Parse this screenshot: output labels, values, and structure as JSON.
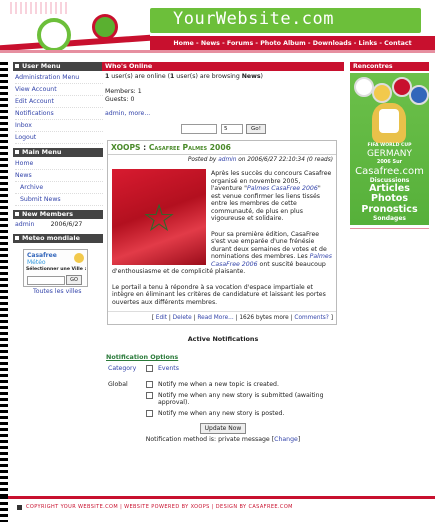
{
  "header": {
    "site_title": "YourWebsite.com",
    "nav": "Home - News - Forums - Photo Album - Downloads - Links - Contact"
  },
  "left": {
    "user_menu": {
      "title": "User Menu",
      "items": [
        "Administration Menu",
        "View Account",
        "Edit Account",
        "Notifications",
        "Inbox",
        "Logout"
      ]
    },
    "main_menu": {
      "title": "Main Menu",
      "items": [
        "Home",
        "News"
      ],
      "sub_items": [
        "Archive",
        "Submit News"
      ]
    },
    "new_members": {
      "title": "New Members",
      "rows": [
        {
          "name": "admin",
          "date": "2006/6/27"
        }
      ]
    },
    "meteo": {
      "title": "Meteo mondiale",
      "brand": "Casafree",
      "brand2": "Météo",
      "prompt": "Sélectionner une Ville :",
      "go_label": "GO",
      "all_cities": "Toutes les villes"
    }
  },
  "center": {
    "whos_online": {
      "title": "Who's Online",
      "line1_pre": "1",
      "line1_mid": " user(s) are online (",
      "line1_num": "1",
      "line1_mid2": " user(s) are browsing ",
      "line1_module": "News",
      "line1_end": ")",
      "members": "Members: 1",
      "guests": "Guests: 0",
      "links": "admin, more..."
    },
    "pager": {
      "value": "5",
      "go_label": "Go!"
    },
    "article": {
      "category": "XOOPS",
      "sep": " : ",
      "title": "Casafree Palmes 2006",
      "posted_pre": "Posted by ",
      "posted_author": "admin",
      "posted_rest": " on 2006/6/27 22:10:34 (0 reads)",
      "p1_a": "Après les succès du concours Casafree organisé en novembre 2005, l'aventure \"",
      "p1_link": "Palmes CasaFree 2006",
      "p1_b": "\" est venue confirmer les liens tissés entre les membres de cette communauté, de plus en plus vigoureuse et solidaire.",
      "p2_a": "Pour sa première édition, CasaFree s'est vue emparée d'une frénésie durant deux semaines de votes et de nominations des membres. Les ",
      "p2_link": "Palmes CasaFree 2006",
      "p2_b": " ont suscité beaucoup d'enthousiasme et de complicité plaisante.",
      "p3": "Le portail a tenu à répondre à sa vocation d'espace impartiale et intègre en éliminant les critères de candidature et laissant les portes ouvertes aux différents membres.",
      "foot_edit": "Edit",
      "foot_delete": "Delete",
      "foot_readmore": "Read More...",
      "foot_bytes": "1626 bytes more",
      "foot_comments": "Comments?"
    },
    "notifications": {
      "title": "Active Notifications",
      "options_title": "Notification Options",
      "category_label": "Category",
      "events_label": "Events",
      "global_label": "Global",
      "options": [
        "Notify me when a new topic is created.",
        "Notify me when any new story is submitted (awaiting approval).",
        "Notify me when any new story is posted."
      ],
      "update_label": "Update Now",
      "method_text": "Notification method is: private message",
      "change_label": "Change"
    }
  },
  "right": {
    "title": "Rencontres",
    "promo": {
      "l1": "FIFA WORLD CUP",
      "l2": "GERMANY",
      "l3": "2006 Sur",
      "l4": "Casafree.com",
      "l5": "Discussions",
      "l6": "Articles",
      "l7": "Photos",
      "l8": "Pronostics",
      "l9": "Sondages"
    }
  },
  "footer": {
    "text": "COPYRIGHT YOUR WEBSITE.COM | WEBSITE POWERED BY XOOPS | DESIGN BY CASAFREE.COM"
  }
}
